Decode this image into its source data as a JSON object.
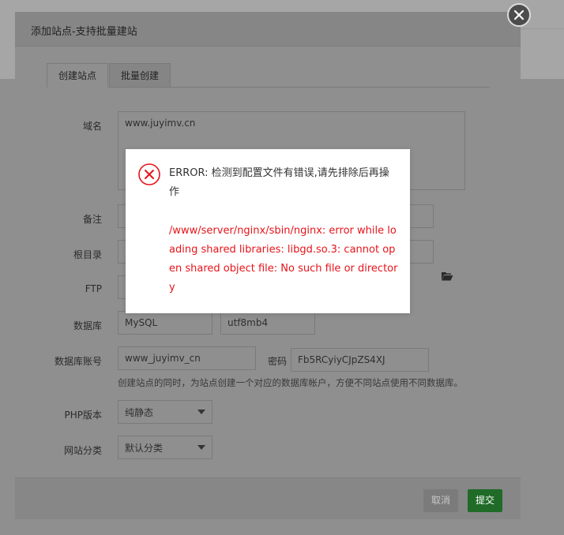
{
  "modal": {
    "title": "添加站点-支持批量建站",
    "tabs": [
      "创建站点",
      "批量创建"
    ]
  },
  "form": {
    "domain_label": "域名",
    "domain_value": "www.juyimv.cn",
    "remark_label": "备注",
    "root_label": "根目录",
    "ftp_label": "FTP",
    "db_label": "数据库",
    "db_type_value": "MySQL",
    "db_charset_value": "utf8mb4",
    "db_account_label": "数据库账号",
    "db_account_value": "www_juyimv_cn",
    "password_label": "密码",
    "password_value": "Fb5RCyiyCJpZS4XJ",
    "hint": "创建站点的同时，为站点创建一个对应的数据库帐户，方便不同站点使用不同数据库。",
    "php_label": "PHP版本",
    "php_value": "纯静态",
    "category_label": "网站分类",
    "category_value": "默认分类"
  },
  "footer": {
    "cancel_label": "取消",
    "submit_label": "提交"
  },
  "error_dialog": {
    "title": "ERROR: 检测到配置文件有错误,请先排除后再操作",
    "message": "/www/server/nginx/sbin/nginx: error while loading shared libraries: libgd.so.3: cannot open shared object file: No such file or directory"
  },
  "colors": {
    "error_red": "#e7141a",
    "submit_green": "#1f6b27"
  },
  "icons": [
    "close-icon",
    "folder-icon",
    "error-icon",
    "chevron-down-icon"
  ]
}
